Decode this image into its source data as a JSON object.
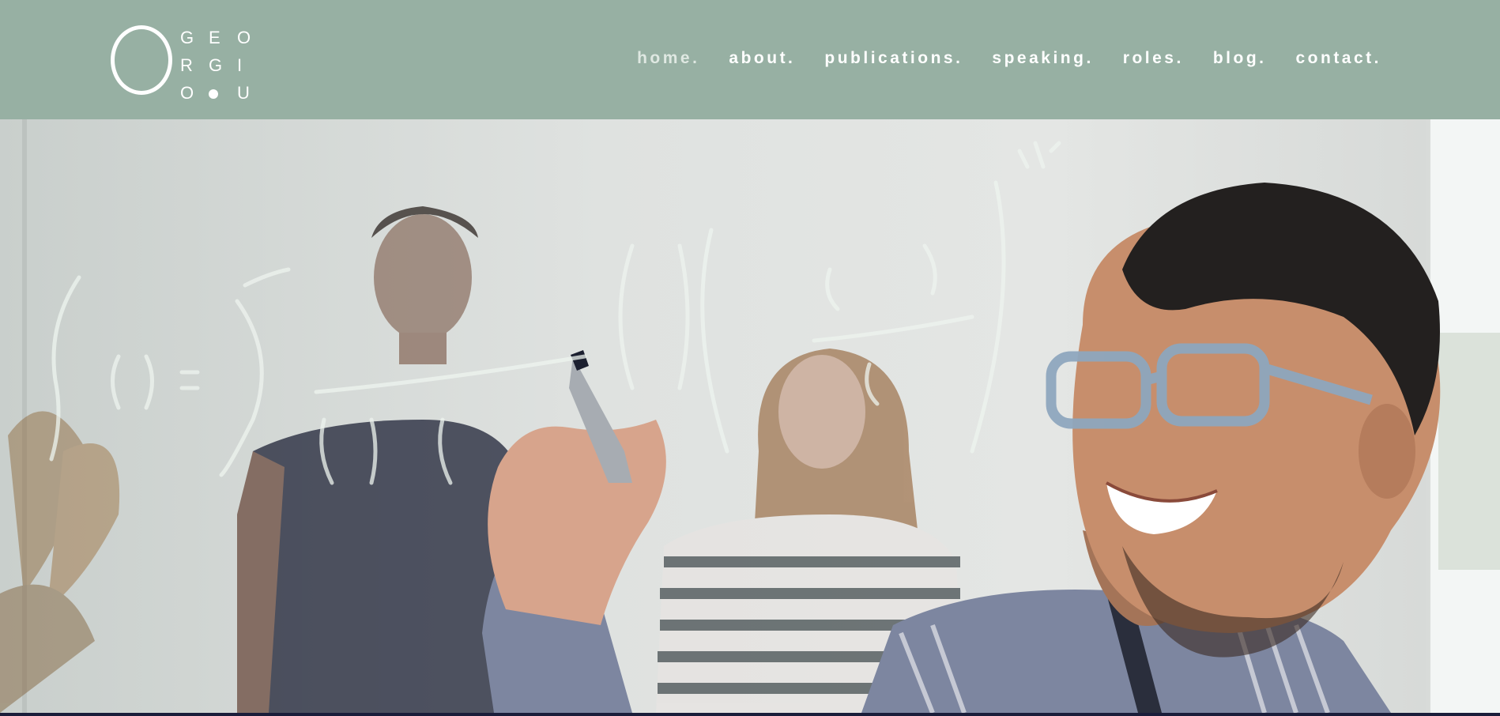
{
  "logo": {
    "letters": [
      "G",
      "E",
      "O",
      "R",
      "G",
      "I",
      "O",
      "",
      "U"
    ]
  },
  "nav": {
    "items": [
      {
        "label": "home.",
        "active": true
      },
      {
        "label": "about.",
        "active": false
      },
      {
        "label": "publications.",
        "active": false
      },
      {
        "label": "speaking.",
        "active": false
      },
      {
        "label": "roles.",
        "active": false
      },
      {
        "label": "blog.",
        "active": false
      },
      {
        "label": "contact.",
        "active": false
      }
    ]
  },
  "colors": {
    "header_bg": "#97b0a3",
    "nav_text": "#ffffff",
    "nav_active": "#dfe8e2"
  }
}
